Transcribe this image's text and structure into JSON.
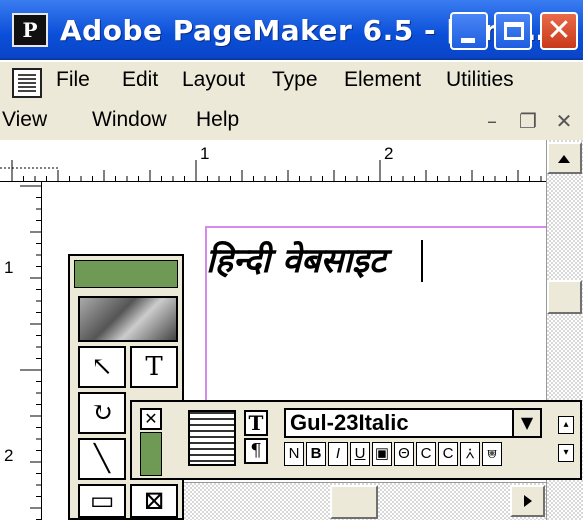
{
  "window": {
    "title": "Adobe PageMaker 6.5 - [Unt…",
    "app_icon_label": "P",
    "controls": {
      "min": "",
      "max": "",
      "close": "✕"
    }
  },
  "menubar": {
    "row1": [
      "File",
      "Edit",
      "Layout",
      "Type",
      "Element",
      "Utilities"
    ],
    "row2": [
      "View",
      "Window",
      "Help"
    ],
    "mdi_min": "–",
    "mdi_restore": "❐",
    "mdi_close": "✕"
  },
  "rulers": {
    "horizontal_labels": [
      "1",
      "2"
    ],
    "vertical_labels": [
      "1",
      "2"
    ]
  },
  "document": {
    "hindi_text": "हिन्दी वेबसाइट"
  },
  "toolbox": {
    "pointer_glyph": "↖",
    "text_glyph": "T",
    "rotate_glyph": "↻",
    "crop_glyph": "▢",
    "line_glyph": "╲",
    "rect_glyph": "▭",
    "frame_glyph": "⊠"
  },
  "control_palette": {
    "close_label": "✕",
    "char_mode": "T",
    "para_mode": "¶",
    "font_name": "Gul-23Italic",
    "dropdown_glyph": "▼",
    "style_buttons": [
      "N",
      "B",
      "I",
      "U",
      "▣",
      "Θ",
      "C",
      "C",
      "⩑",
      "⩐"
    ],
    "side_up": "▴",
    "side_down": "▾"
  },
  "colors": {
    "titlebar": "#0a4fd8",
    "close_button": "#c83a1a",
    "chrome": "#ece9d8",
    "palette_green": "#6f9a55",
    "margin_guides": "#d78aee"
  },
  "icons": [
    "pagemaker-app-icon",
    "document-icon",
    "minimize-icon",
    "maximize-icon",
    "close-icon",
    "scroll-up-icon",
    "scroll-right-icon"
  ]
}
